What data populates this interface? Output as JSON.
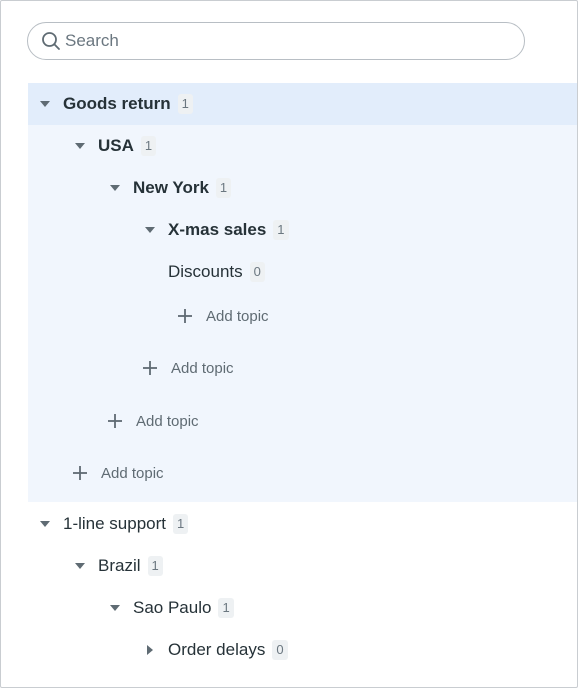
{
  "search": {
    "placeholder": "Search",
    "value": ""
  },
  "tree": {
    "goods_return": {
      "label": "Goods return",
      "count": "1"
    },
    "usa": {
      "label": "USA",
      "count": "1"
    },
    "new_york": {
      "label": "New York",
      "count": "1"
    },
    "xmas_sales": {
      "label": "X-mas sales",
      "count": "1"
    },
    "discounts": {
      "label": "Discounts",
      "count": "0"
    },
    "add_topic_label": "Add topic",
    "one_line_support": {
      "label": "1-line support",
      "count": "1"
    },
    "brazil": {
      "label": "Brazil",
      "count": "1"
    },
    "sao_paulo": {
      "label": "Sao Paulo",
      "count": "1"
    },
    "order_delays": {
      "label": "Order delays",
      "count": "0"
    }
  },
  "icons": {
    "search": "search-icon",
    "expanded": "caret-down-icon",
    "collapsed": "caret-right-icon",
    "add": "plus-icon"
  },
  "colors": {
    "selected_row": "#e2edfb",
    "group_background": "#f1f6fd",
    "text": "#263238",
    "muted": "#6b7780"
  }
}
